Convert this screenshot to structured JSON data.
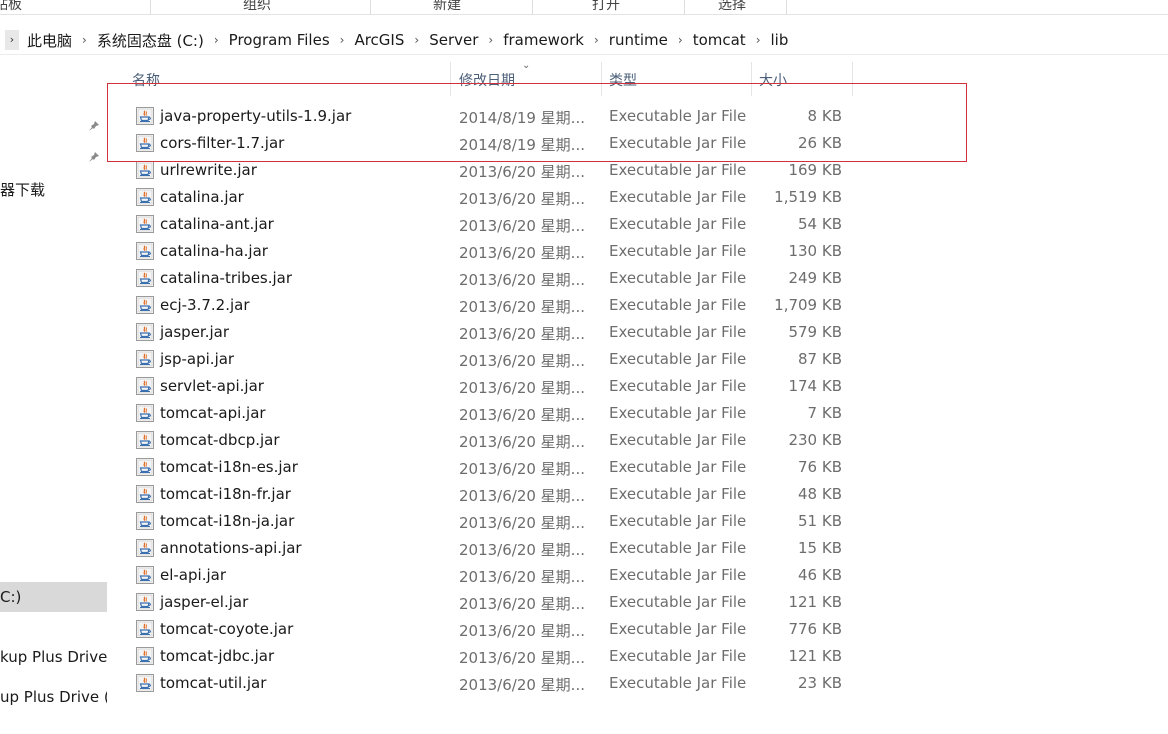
{
  "ribbon": {
    "groups": [
      "贴板",
      "组织",
      "新建",
      "打开",
      "选择"
    ]
  },
  "breadcrumb": {
    "items": [
      "此电脑",
      "系统固态盘 (C:)",
      "Program Files",
      "ArcGIS",
      "Server",
      "framework",
      "runtime",
      "tomcat",
      "lib"
    ]
  },
  "nav": {
    "items": [
      "器下载",
      "C:)",
      "kup Plus Drive (",
      "up Plus Drive (E"
    ]
  },
  "columns": {
    "name": "名称",
    "modified": "修改日期",
    "type": "类型",
    "size": "大小"
  },
  "files": [
    {
      "name": "java-property-utils-1.9.jar",
      "date": "2014/8/19 星期...",
      "type": "Executable Jar File",
      "size": "8 KB"
    },
    {
      "name": "cors-filter-1.7.jar",
      "date": "2014/8/19 星期...",
      "type": "Executable Jar File",
      "size": "26 KB"
    },
    {
      "name": "urlrewrite.jar",
      "date": "2013/6/20 星期...",
      "type": "Executable Jar File",
      "size": "169 KB"
    },
    {
      "name": "catalina.jar",
      "date": "2013/6/20 星期...",
      "type": "Executable Jar File",
      "size": "1,519 KB"
    },
    {
      "name": "catalina-ant.jar",
      "date": "2013/6/20 星期...",
      "type": "Executable Jar File",
      "size": "54 KB"
    },
    {
      "name": "catalina-ha.jar",
      "date": "2013/6/20 星期...",
      "type": "Executable Jar File",
      "size": "130 KB"
    },
    {
      "name": "catalina-tribes.jar",
      "date": "2013/6/20 星期...",
      "type": "Executable Jar File",
      "size": "249 KB"
    },
    {
      "name": "ecj-3.7.2.jar",
      "date": "2013/6/20 星期...",
      "type": "Executable Jar File",
      "size": "1,709 KB"
    },
    {
      "name": "jasper.jar",
      "date": "2013/6/20 星期...",
      "type": "Executable Jar File",
      "size": "579 KB"
    },
    {
      "name": "jsp-api.jar",
      "date": "2013/6/20 星期...",
      "type": "Executable Jar File",
      "size": "87 KB"
    },
    {
      "name": "servlet-api.jar",
      "date": "2013/6/20 星期...",
      "type": "Executable Jar File",
      "size": "174 KB"
    },
    {
      "name": "tomcat-api.jar",
      "date": "2013/6/20 星期...",
      "type": "Executable Jar File",
      "size": "7 KB"
    },
    {
      "name": "tomcat-dbcp.jar",
      "date": "2013/6/20 星期...",
      "type": "Executable Jar File",
      "size": "230 KB"
    },
    {
      "name": "tomcat-i18n-es.jar",
      "date": "2013/6/20 星期...",
      "type": "Executable Jar File",
      "size": "76 KB"
    },
    {
      "name": "tomcat-i18n-fr.jar",
      "date": "2013/6/20 星期...",
      "type": "Executable Jar File",
      "size": "48 KB"
    },
    {
      "name": "tomcat-i18n-ja.jar",
      "date": "2013/6/20 星期...",
      "type": "Executable Jar File",
      "size": "51 KB"
    },
    {
      "name": "annotations-api.jar",
      "date": "2013/6/20 星期...",
      "type": "Executable Jar File",
      "size": "15 KB"
    },
    {
      "name": "el-api.jar",
      "date": "2013/6/20 星期...",
      "type": "Executable Jar File",
      "size": "46 KB"
    },
    {
      "name": "jasper-el.jar",
      "date": "2013/6/20 星期...",
      "type": "Executable Jar File",
      "size": "121 KB"
    },
    {
      "name": "tomcat-coyote.jar",
      "date": "2013/6/20 星期...",
      "type": "Executable Jar File",
      "size": "776 KB"
    },
    {
      "name": "tomcat-jdbc.jar",
      "date": "2013/6/20 星期...",
      "type": "Executable Jar File",
      "size": "121 KB"
    },
    {
      "name": "tomcat-util.jar",
      "date": "2013/6/20 星期...",
      "type": "Executable Jar File",
      "size": "23 KB"
    }
  ],
  "icons": {
    "file": "java-jar-icon",
    "pin": "pin-icon",
    "separator": "chevron-right-icon",
    "sort": "sort-down-icon"
  },
  "colors": {
    "highlight": "#d0313a",
    "header_text": "#4c607a",
    "selected_nav": "#d9d9d9"
  }
}
